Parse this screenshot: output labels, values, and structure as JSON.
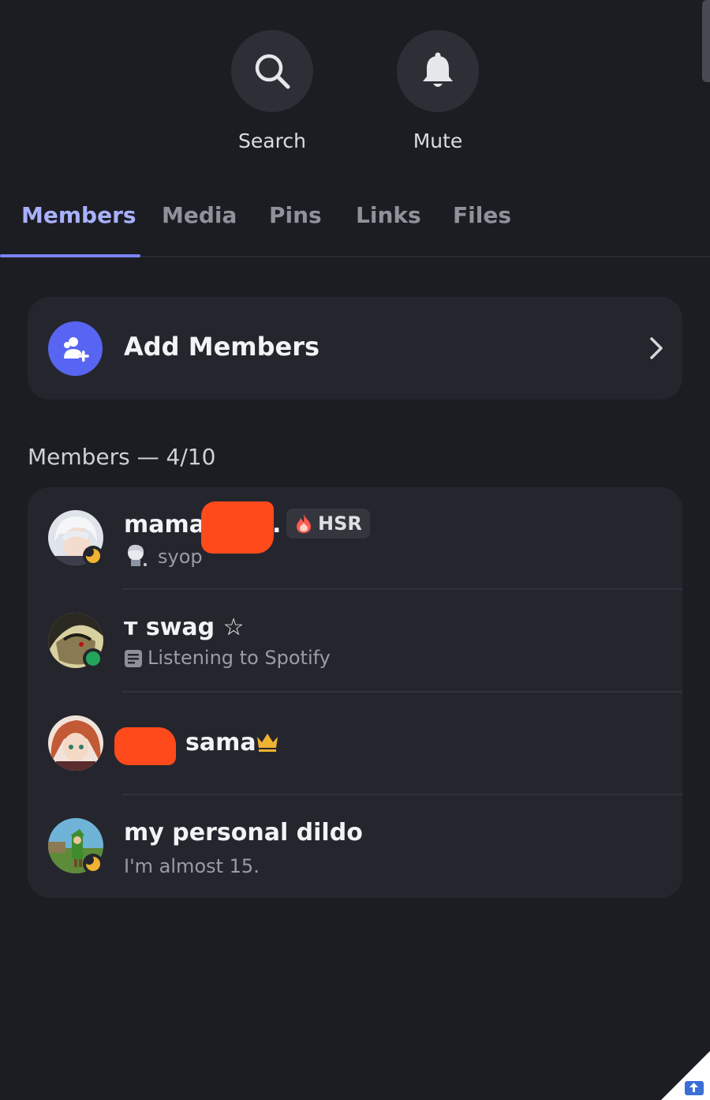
{
  "actions": {
    "search_label": "Search",
    "mute_label": "Mute"
  },
  "tabs": [
    {
      "label": "Members",
      "active": true
    },
    {
      "label": "Media",
      "active": false
    },
    {
      "label": "Pins",
      "active": false
    },
    {
      "label": "Links",
      "active": false
    },
    {
      "label": "Files",
      "active": false
    }
  ],
  "add_members": {
    "label": "Add Members",
    "icon": "add-user-icon"
  },
  "members_section": {
    "header": "Members — 4/10"
  },
  "members": [
    {
      "name": "mama",
      "name_suffix": ".",
      "tag": "HSR",
      "tag_icon": "flame-icon",
      "subtitle": "syop",
      "status": "idle"
    },
    {
      "name": "ᴛ swag ☆",
      "subtitle": "Listening to Spotify",
      "subtitle_icon": "activity-icon",
      "status": "online"
    },
    {
      "name": "sama",
      "badge_icon": "crown-icon",
      "status": "none"
    },
    {
      "name": "my personal dildo",
      "subtitle": "I'm almost 15.",
      "status": "idle"
    }
  ],
  "colors": {
    "background": "#1c1d22",
    "card": "#25262d",
    "accent": "#5865f2",
    "active_tab": "#a8b1ff",
    "online": "#23a55a",
    "idle": "#f0b232",
    "redaction": "#ff4a1c"
  }
}
